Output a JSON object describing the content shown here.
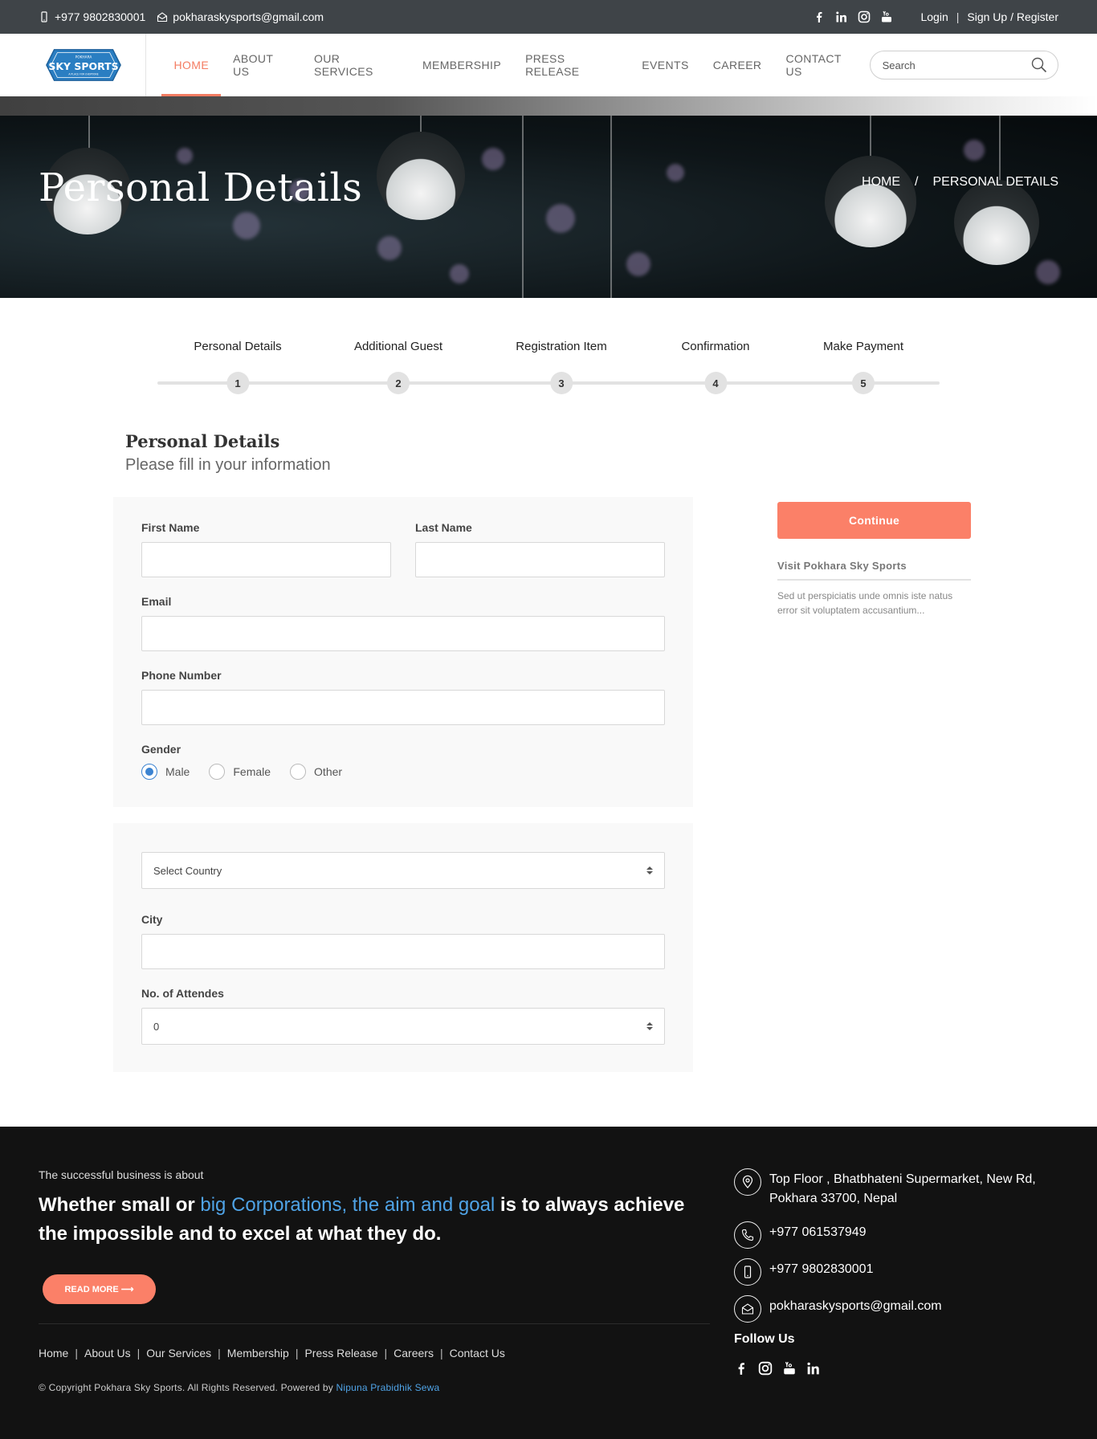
{
  "topbar": {
    "phone": "+977 9802830001",
    "email": "pokharaskysports@gmail.com",
    "login": "Login",
    "signup": "Sign Up / Register",
    "separator": "|"
  },
  "brand": {
    "logo_text": "SKY SPORTS",
    "logo_top": "POKHARA",
    "logo_tagline": "A PLACE FOR EVERYONE"
  },
  "nav": {
    "items": [
      "HOME",
      "ABOUT US",
      "OUR SERVICES",
      "MEMBERSHIP",
      "PRESS RELEASE",
      "EVENTS",
      "CAREER",
      "CONTACT US"
    ],
    "active": "HOME",
    "search_placeholder": "Search"
  },
  "hero": {
    "title": "Personal Details",
    "breadcrumb": [
      "HOME",
      "/",
      "PERSONAL DETAILS"
    ]
  },
  "steps": [
    {
      "label": "Personal Details",
      "num": "1"
    },
    {
      "label": "Additional Guest",
      "num": "2"
    },
    {
      "label": "Registration Item",
      "num": "3"
    },
    {
      "label": "Confirmation",
      "num": "4"
    },
    {
      "label": "Make Payment",
      "num": "5"
    }
  ],
  "form": {
    "heading": "Personal Details",
    "subheading": "Please fill in your information",
    "first_name_label": "First Name",
    "last_name_label": "Last Name",
    "email_label": "Email",
    "phone_label": "Phone Number",
    "gender_label": "Gender",
    "gender_options": [
      "Male",
      "Female",
      "Other"
    ],
    "gender_selected": "Male",
    "country_value": "Select Country",
    "city_label": "City",
    "attendees_label": "No. of Attendes",
    "attendees_value": "0"
  },
  "side": {
    "continue_label": "Continue",
    "visit_title": "Visit Pokhara Sky Sports",
    "visit_text": "Sed ut perspiciatis unde omnis iste natus error sit voluptatem accusantium..."
  },
  "footer": {
    "intro": "The successful business is about",
    "headline_pre": "Whether small or ",
    "headline_highlight": "big Corporations, the aim and goal",
    "headline_post": " is to always achieve the impossible and to excel at what they do.",
    "read_more": "READ MORE ⟶",
    "links": [
      "Home",
      "About Us",
      "Our Services",
      "Membership",
      "Press Release",
      "Careers",
      "Contact Us"
    ],
    "link_sep": "|",
    "copyright": "© Copyright Pokhara Sky Sports. All Rights Reserved. Powered by ",
    "powered_by": "Nipuna Prabidhik Sewa",
    "address": "Top Floor , Bhatbhateni Supermarket, New Rd, Pokhara 33700, Nepal",
    "landline": "+977 061537949",
    "mobile": "+977 9802830001",
    "email": "pokharaskysports@gmail.com",
    "follow": "Follow Us"
  },
  "colors": {
    "accent": "#fb8068",
    "link": "#4fa3e6",
    "topbar": "#3f4448",
    "footer": "#121212"
  }
}
